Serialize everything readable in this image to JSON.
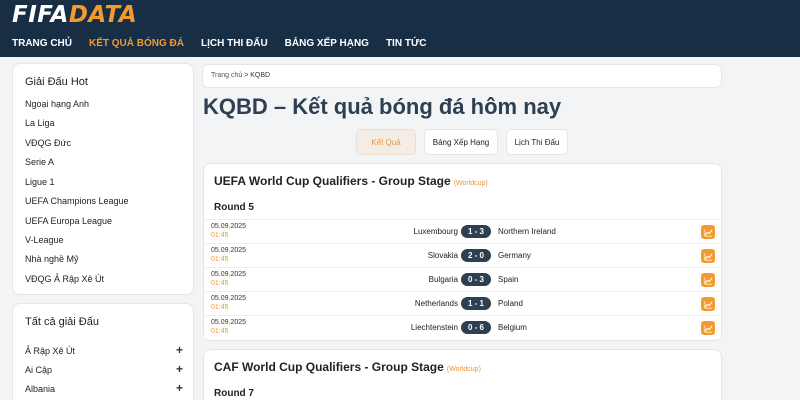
{
  "header": {
    "logo_part1": "FIFA",
    "logo_part2": "DATA",
    "nav": [
      "TRANG CHỦ",
      "KẾT QUẢ BÓNG ĐÁ",
      "LỊCH THI ĐẤU",
      "BẢNG XẾP HẠNG",
      "TIN TỨC"
    ]
  },
  "sidebar_hot": {
    "title": "Giải Đấu Hot",
    "items": [
      "Ngoại hạng Anh",
      "La Liga",
      "VĐQG Đức",
      "Serie A",
      "Ligue 1",
      "UEFA Champions League",
      "UEFA Europa League",
      "V-League",
      "Nhà nghề Mỹ",
      "VĐQG Ả Rập Xê Út"
    ]
  },
  "sidebar_all": {
    "title": "Tất cả giải Đấu",
    "items": [
      "Ả Rập Xê Út",
      "Ai Cập",
      "Albania"
    ]
  },
  "breadcrumb": {
    "home": "Trang chủ",
    "sep": ">",
    "current": "KQBD"
  },
  "page_title": "KQBD – Kết quả bóng đá hôm nay",
  "tabs": [
    "Kết Quả",
    "Bảng Xếp Hạng",
    "Lịch Thi Đấu"
  ],
  "sections": [
    {
      "title": "UEFA World Cup Qualifiers - Group Stage",
      "tag": "(Worldcup)",
      "round": "Round 5",
      "matches": [
        {
          "date": "05.09.2025",
          "time": "01:45",
          "home": "Luxembourg",
          "score": "1 - 3",
          "away": "Northern Ireland"
        },
        {
          "date": "05.09.2025",
          "time": "01:45",
          "home": "Slovakia",
          "score": "2 - 0",
          "away": "Germany"
        },
        {
          "date": "05.09.2025",
          "time": "01:45",
          "home": "Bulgaria",
          "score": "0 - 3",
          "away": "Spain"
        },
        {
          "date": "05.09.2025",
          "time": "01:45",
          "home": "Netherlands",
          "score": "1 - 1",
          "away": "Poland"
        },
        {
          "date": "05.09.2025",
          "time": "01:45",
          "home": "Liechtenstein",
          "score": "0 - 6",
          "away": "Belgium"
        }
      ]
    },
    {
      "title": "CAF World Cup Qualifiers - Group Stage",
      "tag": "(Worldcup)",
      "round": "Round 7",
      "matches": []
    }
  ],
  "colors": {
    "header_bg": "#182e45",
    "accent": "#f29a2e",
    "score_bg": "#2f3f52"
  }
}
